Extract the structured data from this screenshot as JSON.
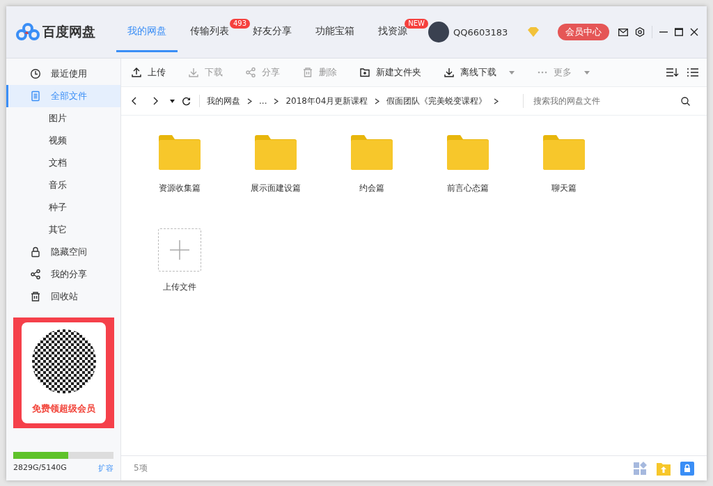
{
  "app": {
    "name": "百度网盘"
  },
  "tabs": [
    {
      "label": "我的网盘",
      "selected": true
    },
    {
      "label": "传输列表",
      "selected": false,
      "badge": "493"
    },
    {
      "label": "好友分享",
      "selected": false
    },
    {
      "label": "功能宝箱",
      "selected": false
    },
    {
      "label": "找资源",
      "selected": false,
      "badge": "NEW"
    }
  ],
  "user": {
    "name": "QQ6603183",
    "vip_button": "会员中心"
  },
  "toolbar": {
    "actions": [
      {
        "label": "上传",
        "disabled": false,
        "dropdown": false
      },
      {
        "label": "下载",
        "disabled": true,
        "dropdown": false
      },
      {
        "label": "分享",
        "disabled": true,
        "dropdown": false
      },
      {
        "label": "删除",
        "disabled": true,
        "dropdown": false
      },
      {
        "label": "新建文件夹",
        "disabled": false,
        "dropdown": false
      },
      {
        "label": "离线下载",
        "disabled": false,
        "dropdown": true
      },
      {
        "label": "更多",
        "disabled": true,
        "dropdown": true
      }
    ]
  },
  "breadcrumb": [
    "我的网盘",
    "...",
    "2018年04月更新课程",
    "假面团队《完美蜕变课程》"
  ],
  "search": {
    "placeholder": "搜索我的网盘文件"
  },
  "sidebar": {
    "items": [
      {
        "label": "最近使用",
        "selected": false
      },
      {
        "label": "全部文件",
        "selected": true,
        "children": [
          {
            "label": "图片",
            "selected": false
          },
          {
            "label": "视频",
            "selected": false
          },
          {
            "label": "文档",
            "selected": false
          },
          {
            "label": "音乐",
            "selected": false
          },
          {
            "label": "种子",
            "selected": false
          },
          {
            "label": "其它",
            "selected": false
          }
        ]
      },
      {
        "label": "隐藏空间",
        "selected": false
      },
      {
        "label": "我的分享",
        "selected": false
      },
      {
        "label": "回收站",
        "selected": false
      }
    ],
    "promo": {
      "caption": "免费领超级会员"
    },
    "storage": {
      "level": 0.55,
      "usage": "2829G/5140G",
      "expand_link": "扩容"
    }
  },
  "files": [
    {
      "name": "资源收集篇",
      "kind": "folder"
    },
    {
      "name": "展示面建设篇",
      "kind": "folder"
    },
    {
      "name": "约会篇",
      "kind": "folder"
    },
    {
      "name": "前言心态篇",
      "kind": "folder"
    },
    {
      "name": "聊天篇",
      "kind": "folder"
    },
    {
      "name": "上传文件",
      "kind": "upload"
    }
  ],
  "status_bar": {
    "count": "5项"
  }
}
